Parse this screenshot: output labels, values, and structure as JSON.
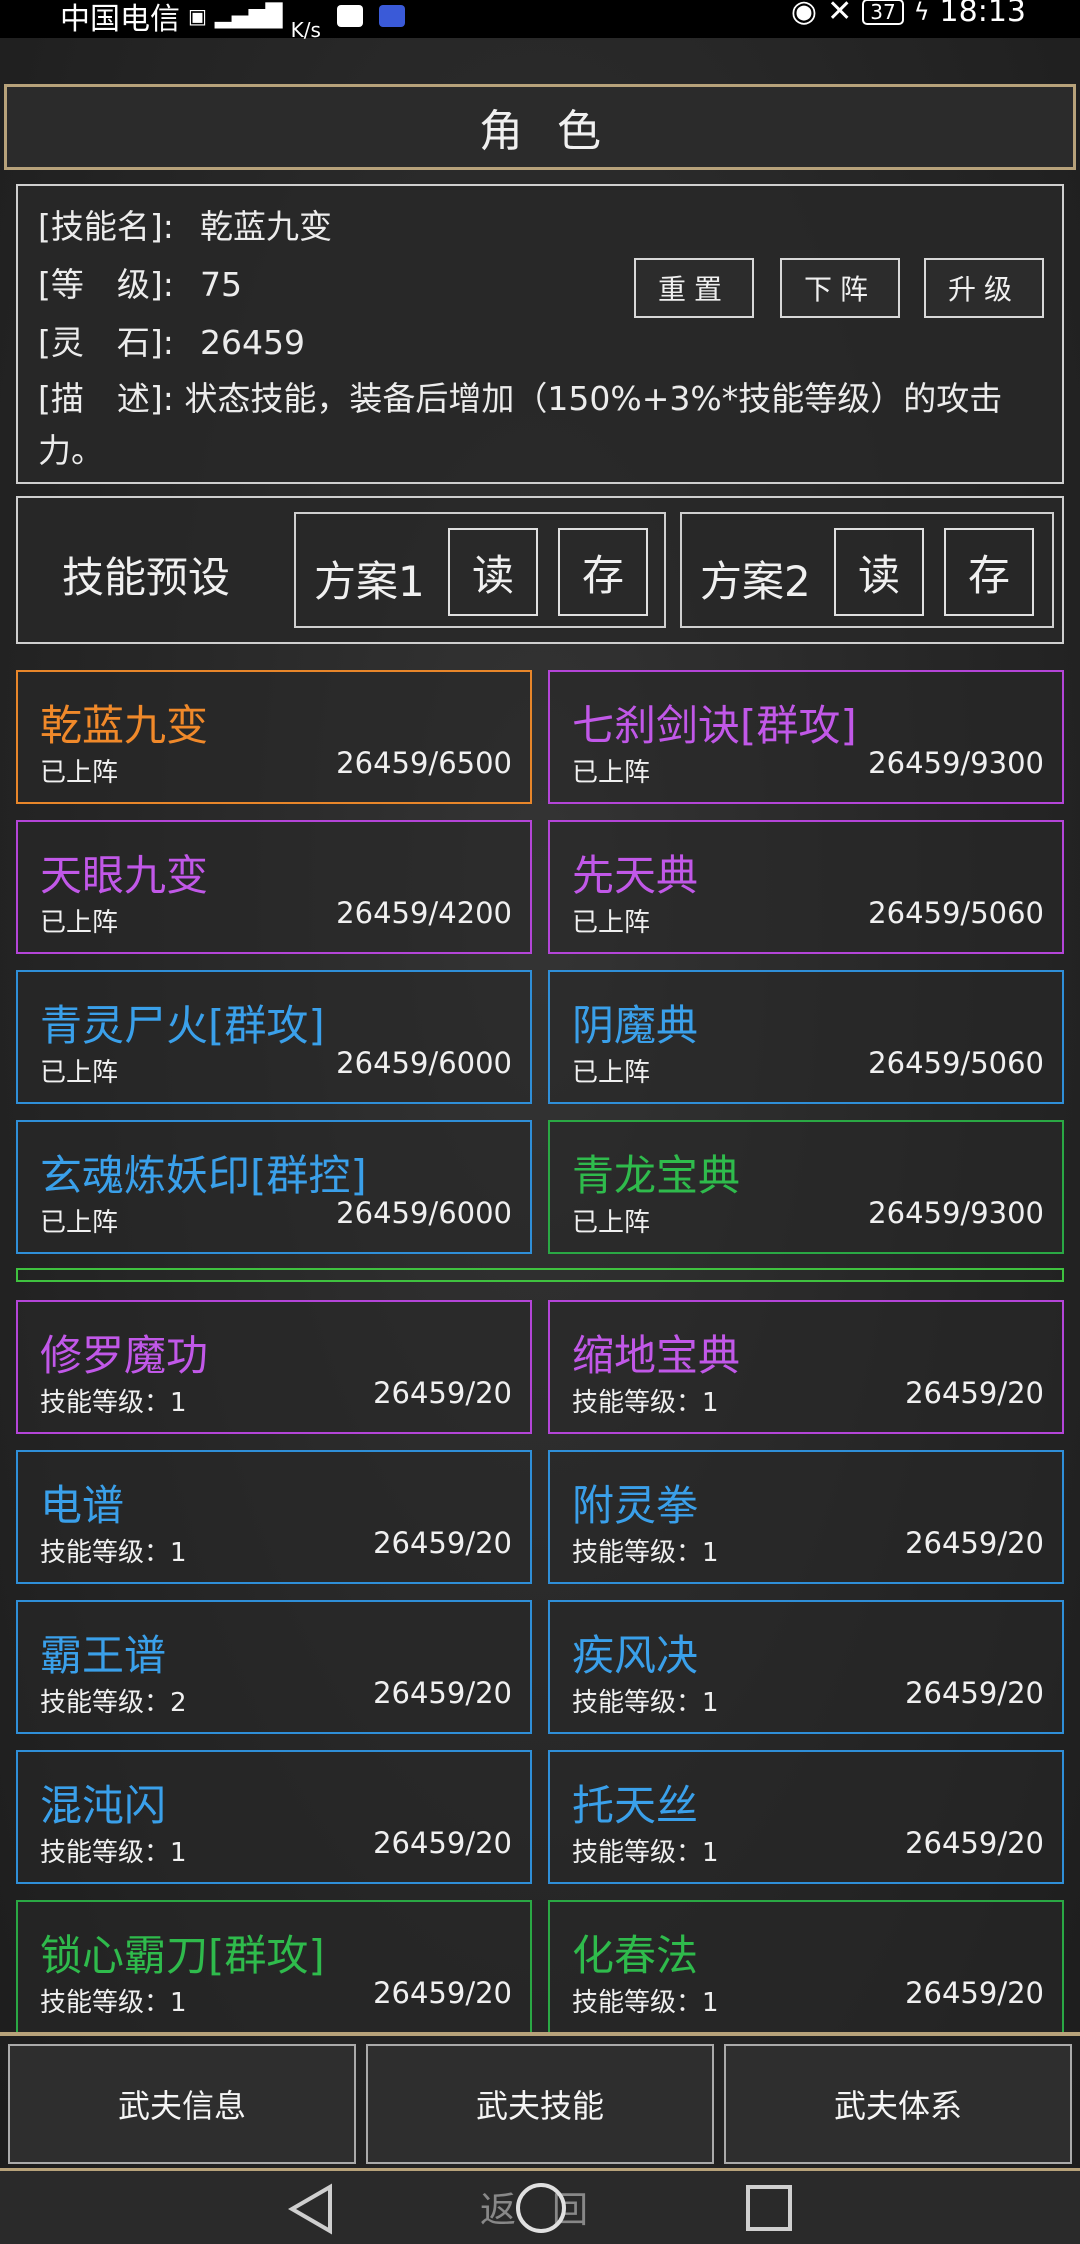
{
  "status_bar": {
    "carrier": "中国电信",
    "speed_unit": "K/s",
    "battery": "37",
    "time": "18:13"
  },
  "header": {
    "title": "角色"
  },
  "skill_info": {
    "name_label": "[技能名]:",
    "name_value": "乾蓝九变",
    "level_label": "[等　级]:",
    "level_value": "75",
    "stone_label": "[灵　石]:",
    "stone_value": "26459",
    "desc_label": "[描　述]:",
    "desc_value": "状态技能，装备后增加（150%+3%*技能等级）的攻击力。",
    "buttons": {
      "reset": "重置",
      "unequip": "下阵",
      "upgrade": "升级"
    }
  },
  "presets": {
    "title": "技能预设",
    "plans": [
      {
        "name": "方案1",
        "read": "读",
        "save": "存"
      },
      {
        "name": "方案2",
        "read": "读",
        "save": "存"
      }
    ]
  },
  "equipped_skills": [
    {
      "name": "乾蓝九变",
      "status": "已上阵",
      "cost": "26459/6500",
      "rarity": "orange"
    },
    {
      "name": "七刹剑诀[群攻]",
      "status": "已上阵",
      "cost": "26459/9300",
      "rarity": "purple"
    },
    {
      "name": "天眼九变",
      "status": "已上阵",
      "cost": "26459/4200",
      "rarity": "purple"
    },
    {
      "name": "先天典",
      "status": "已上阵",
      "cost": "26459/5060",
      "rarity": "purple"
    },
    {
      "name": "青灵尸火[群攻]",
      "status": "已上阵",
      "cost": "26459/6000",
      "rarity": "blue"
    },
    {
      "name": "阴魔典",
      "status": "已上阵",
      "cost": "26459/5060",
      "rarity": "blue"
    },
    {
      "name": "玄魂炼妖印[群控]",
      "status": "已上阵",
      "cost": "26459/6000",
      "rarity": "blue"
    },
    {
      "name": "青龙宝典",
      "status": "已上阵",
      "cost": "26459/9300",
      "rarity": "green"
    }
  ],
  "other_skills": [
    {
      "name": "修罗魔功",
      "status": "技能等级：1",
      "cost": "26459/20",
      "rarity": "purple"
    },
    {
      "name": "缩地宝典",
      "status": "技能等级：1",
      "cost": "26459/20",
      "rarity": "purple"
    },
    {
      "name": "电谱",
      "status": "技能等级：1",
      "cost": "26459/20",
      "rarity": "blue"
    },
    {
      "name": "附灵拳",
      "status": "技能等级：1",
      "cost": "26459/20",
      "rarity": "blue"
    },
    {
      "name": "霸王谱",
      "status": "技能等级：2",
      "cost": "26459/20",
      "rarity": "blue"
    },
    {
      "name": "疾风决",
      "status": "技能等级：1",
      "cost": "26459/20",
      "rarity": "blue"
    },
    {
      "name": "混沌闪",
      "status": "技能等级：1",
      "cost": "26459/20",
      "rarity": "blue"
    },
    {
      "name": "托天丝",
      "status": "技能等级：1",
      "cost": "26459/20",
      "rarity": "blue"
    },
    {
      "name": "锁心霸刀[群攻]",
      "status": "技能等级：1",
      "cost": "26459/20",
      "rarity": "green"
    },
    {
      "name": "化春法",
      "status": "技能等级：1",
      "cost": "26459/20",
      "rarity": "green"
    }
  ],
  "bottom_tabs": [
    "武夫信息",
    "武夫技能",
    "武夫体系"
  ],
  "nav_bar": {
    "back_text": "返回"
  },
  "colors": {
    "orange": "#f0892a",
    "purple": "#c158e8",
    "blue": "#3aa0ea",
    "green": "#2fbb4c",
    "frame": "#b7a27a"
  }
}
